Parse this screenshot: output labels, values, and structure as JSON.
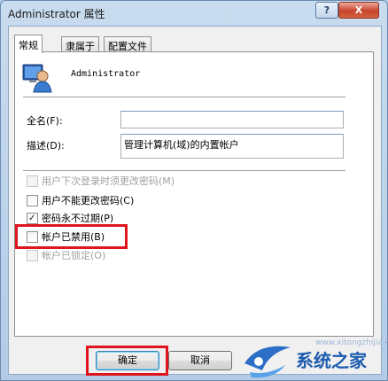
{
  "window": {
    "title": "Administrator 属性",
    "help_label": "?",
    "close_label": "X"
  },
  "tabs": [
    {
      "label": "常规",
      "active": true
    },
    {
      "label": "隶属于",
      "active": false
    },
    {
      "label": "配置文件",
      "active": false
    }
  ],
  "user": {
    "name": "Administrator",
    "icon": "user-icon"
  },
  "fields": {
    "fullname_label": "全名(F):",
    "fullname_value": "",
    "description_label": "描述(D):",
    "description_value": "管理计算机(域)的内置帐户"
  },
  "checkboxes": [
    {
      "label": "用户下次登录时须更改密码(M)",
      "checked": false,
      "disabled": true
    },
    {
      "label": "用户不能更改密码(C)",
      "checked": false,
      "disabled": false
    },
    {
      "label": "密码永不过期(P)",
      "checked": true,
      "disabled": false
    },
    {
      "label": "帐户已禁用(B)",
      "checked": false,
      "disabled": false
    },
    {
      "label": "帐户已锁定(O)",
      "checked": false,
      "disabled": true
    }
  ],
  "buttons": {
    "ok": "确定",
    "cancel": "取消"
  },
  "watermark": {
    "text": "系统之家",
    "url": "www.xitongzhijia.net"
  },
  "colors": {
    "highlight_red": "#e0141e",
    "brand_blue": "#1e5cae"
  }
}
